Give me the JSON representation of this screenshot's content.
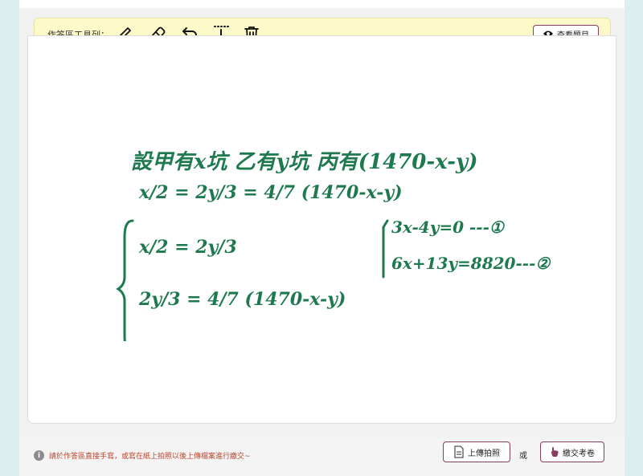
{
  "toolbar": {
    "label": "作答區工具列：",
    "tools": [
      {
        "name": "pen-icon"
      },
      {
        "name": "eraser-icon"
      },
      {
        "name": "undo-icon"
      },
      {
        "name": "move-down-icon"
      },
      {
        "name": "trash-icon"
      }
    ],
    "view_question_label": "查看題目"
  },
  "canvas": {
    "lines": [
      "設甲有x坑  乙有y坑  丙有(1470-x-y)",
      "x/2 = 2y/3 = 4/7 (1470-x-y)",
      "x/2 = 2y/3",
      "2y/3 = 4/7 (1470-x-y)",
      "3x-4y=0 ---①",
      "6x+13y=8820---②"
    ]
  },
  "footer": {
    "notice": "請於作答區直接手寫，或寫在紙上拍照以後上傳檔案進行繳交~",
    "upload_label": "上傳拍照",
    "or_label": "或",
    "submit_label": "繳交考卷"
  },
  "colors": {
    "ink": "#1e7a4e",
    "toolbar_bg": "#fdf9c9",
    "accent": "#8a3d5c",
    "notice": "#b5462f"
  }
}
